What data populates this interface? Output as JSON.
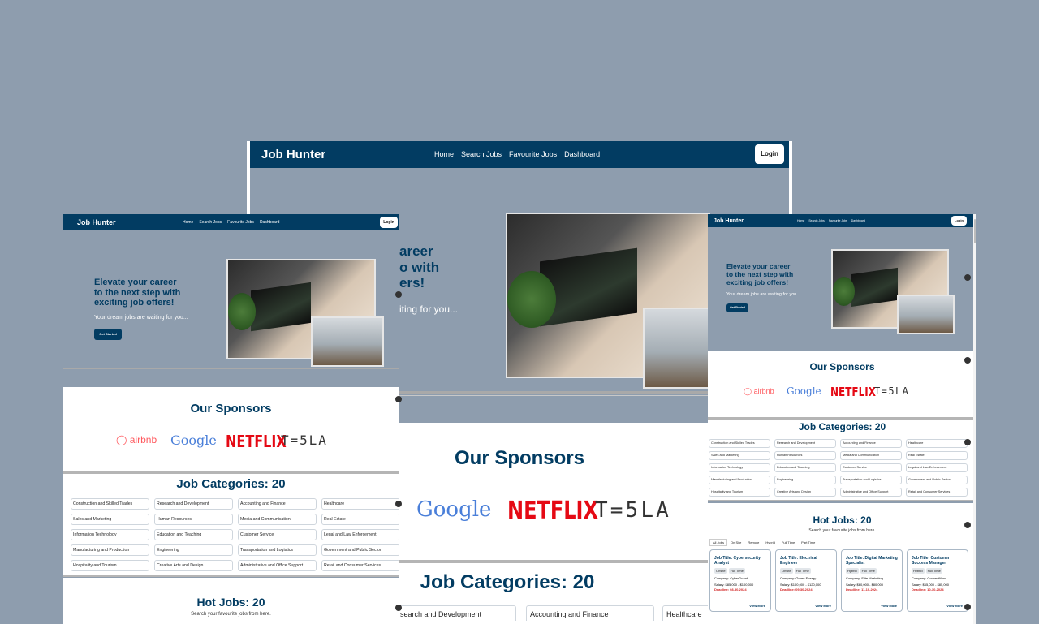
{
  "brand": "Job Hunter",
  "nav": [
    "Home",
    "Search Jobs",
    "Favourite Jobs",
    "Dashboard"
  ],
  "login": "Login",
  "hero": {
    "title_lines": [
      "Elevate your career",
      "to the next step with",
      "exciting job offers!"
    ],
    "center_title_lines": [
      "areer",
      "o with",
      "ers!"
    ],
    "subtitle": "Your dream jobs are waiting for you...",
    "center_subtitle": "iting for you...",
    "cta": "Get Started"
  },
  "sponsors": {
    "title": "Our Sponsors",
    "logos": [
      "airbnb",
      "Google",
      "NETFLIX",
      "TESLA"
    ],
    "tesla_display": "T=5LA"
  },
  "categories": {
    "title": "Job Categories: 20",
    "items": [
      "Construction and Skilled Trades",
      "Research and Development",
      "Accounting and Finance",
      "Healthcare",
      "Sales and Marketing",
      "Human Resources",
      "Media and Communication",
      "Real Estate",
      "Information Technology",
      "Education and Teaching",
      "Customer Service",
      "Legal and Law Enforcement",
      "Manufacturing and Production",
      "Engineering",
      "Transportation and Logistics",
      "Government and Public Sector",
      "Hospitality and Tourism",
      "Creative Arts and Design",
      "Administrative and Office Support",
      "Retail and Consumer Services"
    ],
    "center_first": "search and Development"
  },
  "hot_jobs": {
    "title": "Hot Jobs: 20",
    "subtitle": "Search your favourite jobs from here.",
    "tabs": [
      "All Jobs",
      "On Site",
      "Remote",
      "Hybrid",
      "Full Time",
      "Part Time"
    ],
    "cards": [
      {
        "title": "Job Title: Cybersecurity Analyst",
        "tags": [
          "Onsite",
          "Full Time"
        ],
        "company": "Company: CyberGuard",
        "salary": "Salary: $85,000 - $100,000",
        "deadline": "Deadline: 08-30-2024",
        "more": "View More"
      },
      {
        "title": "Job Title: Electrical Engineer",
        "tags": [
          "Onsite",
          "Full Time"
        ],
        "company": "Company: Green Energy",
        "salary": "Salary: $100,000 - $120,000",
        "deadline": "Deadline: 09-30-2024",
        "more": "View More"
      },
      {
        "title": "Job Title: Digital Marketing Specialist",
        "tags": [
          "Hybrid",
          "Full Time"
        ],
        "company": "Company: Elite Marketing",
        "salary": "Salary: $60,000 - $80,000",
        "deadline": "Deadline: 11-10-2024",
        "more": "View More"
      },
      {
        "title": "Job Title: Customer Success Manager",
        "tags": [
          "Hybrid",
          "Full Time"
        ],
        "company": "Company: ConnectNow",
        "salary": "Salary: $65,000 - $85,000",
        "deadline": "Deadline: 10-30-2024",
        "more": "View More"
      }
    ]
  }
}
